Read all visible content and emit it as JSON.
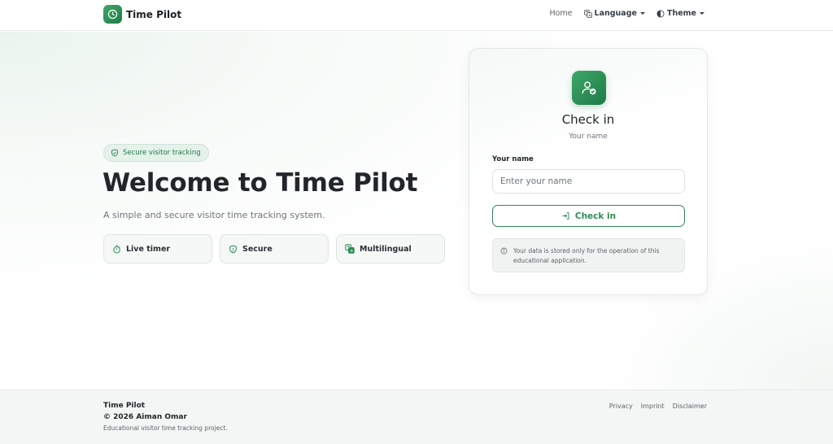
{
  "navbar": {
    "brand": "Time Pilot",
    "brand_icon": "clock-icon",
    "links": {
      "home": "Home",
      "language": "Language",
      "theme": "Theme"
    }
  },
  "hero": {
    "badge": "Secure visitor tracking",
    "title": "Welcome to Time Pilot",
    "subtitle": "A simple and secure visitor time tracking system.",
    "features": [
      {
        "label": "Live timer",
        "icon": "stopwatch-icon"
      },
      {
        "label": "Secure",
        "icon": "shield-icon"
      },
      {
        "label": "Multilingual",
        "icon": "translate-icon"
      }
    ]
  },
  "checkin": {
    "title": "Check in",
    "subtitle": "Your name",
    "field_label": "Your name",
    "placeholder": "Enter your name",
    "value": "",
    "button": "Check in",
    "notice": "Your data is stored only for the operation of this educational application."
  },
  "footer": {
    "name": "Time Pilot",
    "copyright": "© 2026 Aiman Omar",
    "description": "Educational visitor time tracking project.",
    "links": [
      "Privacy",
      "Imprint",
      "Disclaimer"
    ]
  },
  "colors": {
    "accent": "#2e8b57",
    "accent_dark": "#1e7a47",
    "badge_bg": "#e5f2ea"
  }
}
